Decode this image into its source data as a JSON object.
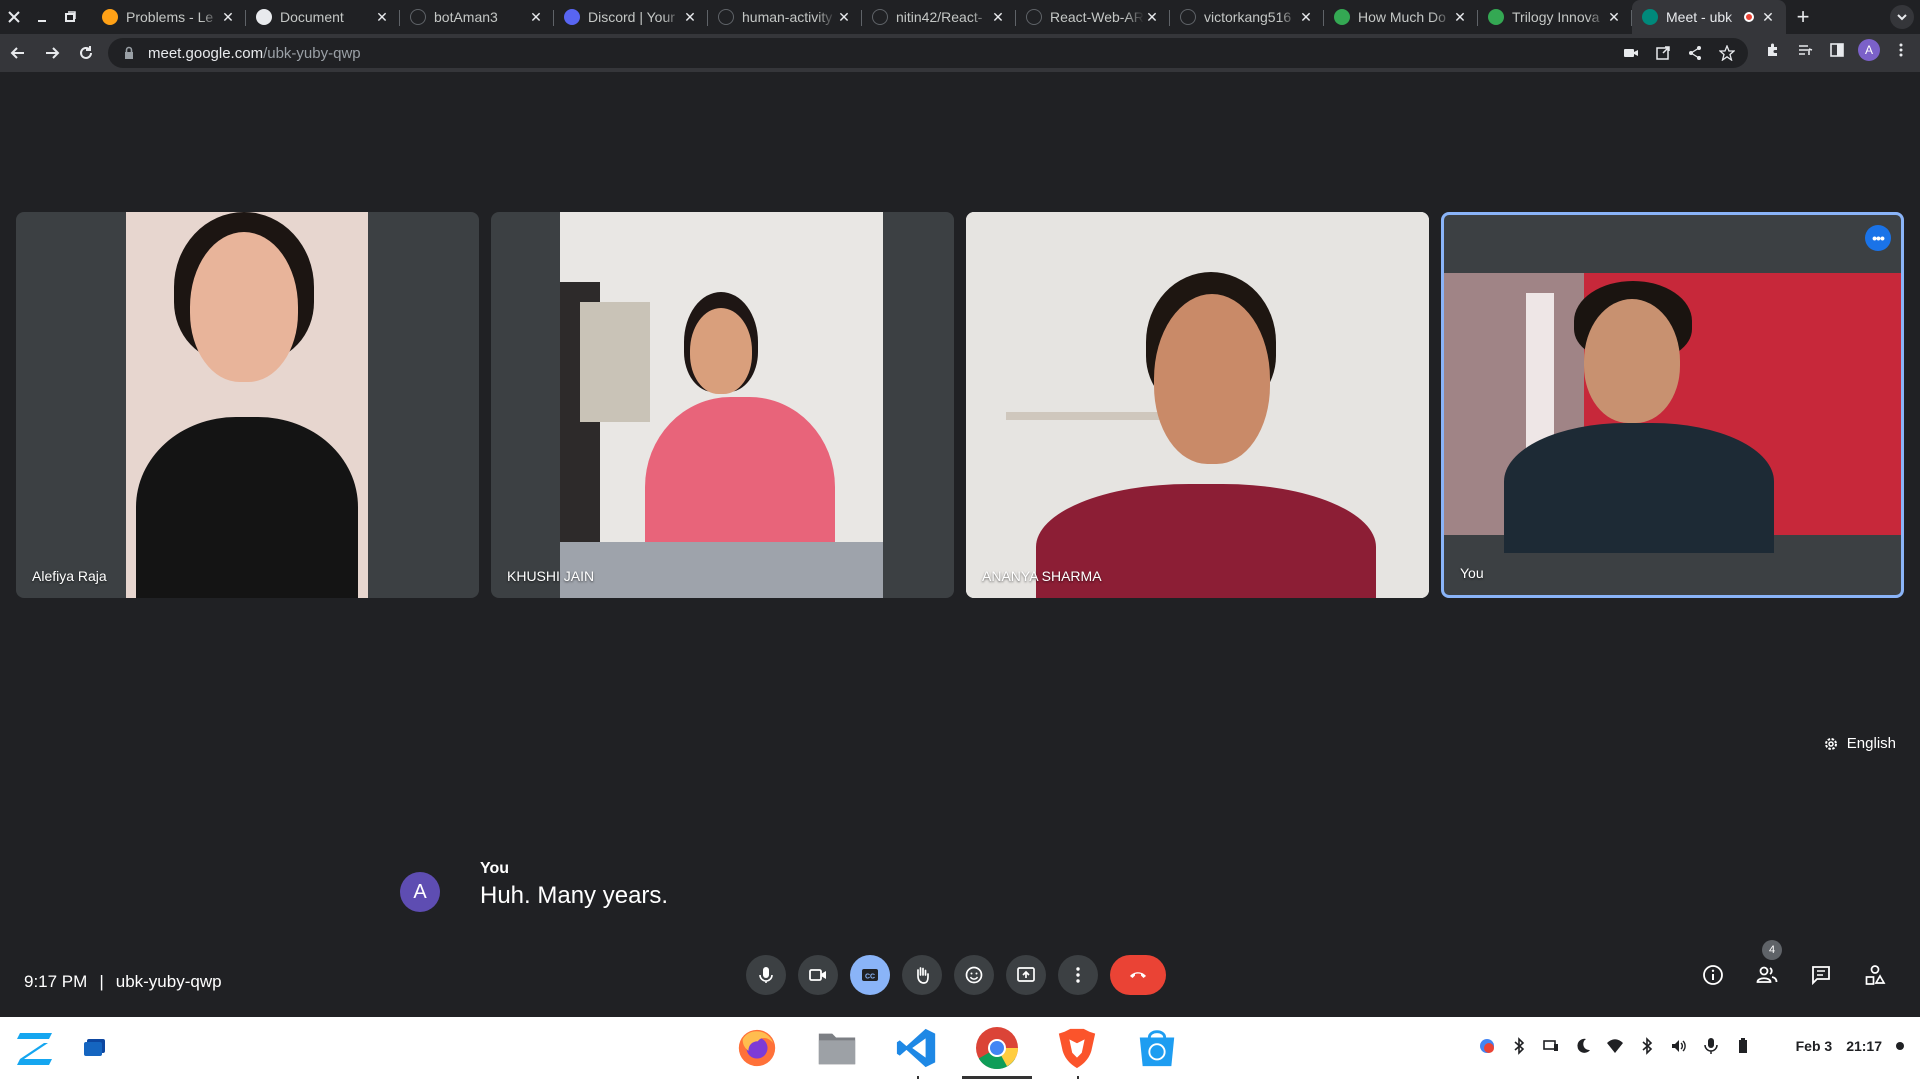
{
  "browser": {
    "tabs": [
      {
        "title": "Problems - Le",
        "favicon": "leetcode-icon",
        "color": "#ffa116"
      },
      {
        "title": "Document",
        "favicon": "globe-icon",
        "color": "#e8eaed"
      },
      {
        "title": "botAman3",
        "favicon": "github-icon",
        "color": "#303134"
      },
      {
        "title": "Discord | Your",
        "favicon": "discord-icon",
        "color": "#5865f2"
      },
      {
        "title": "human-activity",
        "favicon": "github-icon",
        "color": "#303134"
      },
      {
        "title": "nitin42/React-",
        "favicon": "github-icon",
        "color": "#303134"
      },
      {
        "title": "React-Web-AR",
        "favicon": "github-icon",
        "color": "#303134"
      },
      {
        "title": "victorkang516",
        "favicon": "github-icon",
        "color": "#303134"
      },
      {
        "title": "How Much Do",
        "favicon": "phone-icon",
        "color": "#34a853"
      },
      {
        "title": "Trilogy Innova",
        "favicon": "trilogy-icon",
        "color": "#34a853"
      },
      {
        "title": "Meet - ubk",
        "favicon": "meet-icon",
        "color": "#00897b",
        "active": true
      }
    ],
    "url_host": "meet.google.com",
    "url_path": "/ubk-yuby-qwp",
    "profile_initial": "A"
  },
  "participants": [
    {
      "name": "Alefiya Raja",
      "bg": "#3c4043",
      "wall": "#e7d6cf",
      "skin": "#e8b49a",
      "hair": "#1c1512",
      "shirt": "#121212"
    },
    {
      "name": "KHUSHI JAIN",
      "bg": "#3c4043",
      "wall": "#e9e7e4",
      "skin": "#d99f7c",
      "hair": "#1e1614",
      "shirt": "#e8647a"
    },
    {
      "name": "ANANYA SHARMA",
      "bg": "#e6e4e1",
      "wall": "#e6e4e1",
      "skin": "#c98a68",
      "hair": "#1e1611",
      "shirt": "#8c1e35"
    },
    {
      "name": "You",
      "bg": "#3c4043",
      "wall": "#c7283a",
      "skin": "#c89170",
      "hair": "#1a1410",
      "shirt": "#1d2a35"
    }
  ],
  "caption": {
    "avatar": "A",
    "speaker": "You",
    "text": "Huh. Many years."
  },
  "language": "English",
  "meeting": {
    "time": "9:17 PM",
    "separator": "|",
    "code": "ubk-yuby-qwp"
  },
  "controls": [
    "mic-icon",
    "camera-icon",
    "captions-icon",
    "raise-hand-icon",
    "emoji-icon",
    "present-icon",
    "more-options-icon",
    "hangup-icon"
  ],
  "right_controls": {
    "people_count": "4"
  },
  "taskbar": {
    "apps": [
      "firefox-icon",
      "files-icon",
      "vscode-icon",
      "chrome-icon",
      "brave-icon",
      "store-icon"
    ],
    "date": "Feb 3",
    "time": "21:17"
  },
  "colors": {
    "accent": "#8ab4f8",
    "hangup": "#ea4335",
    "background": "#202124"
  }
}
